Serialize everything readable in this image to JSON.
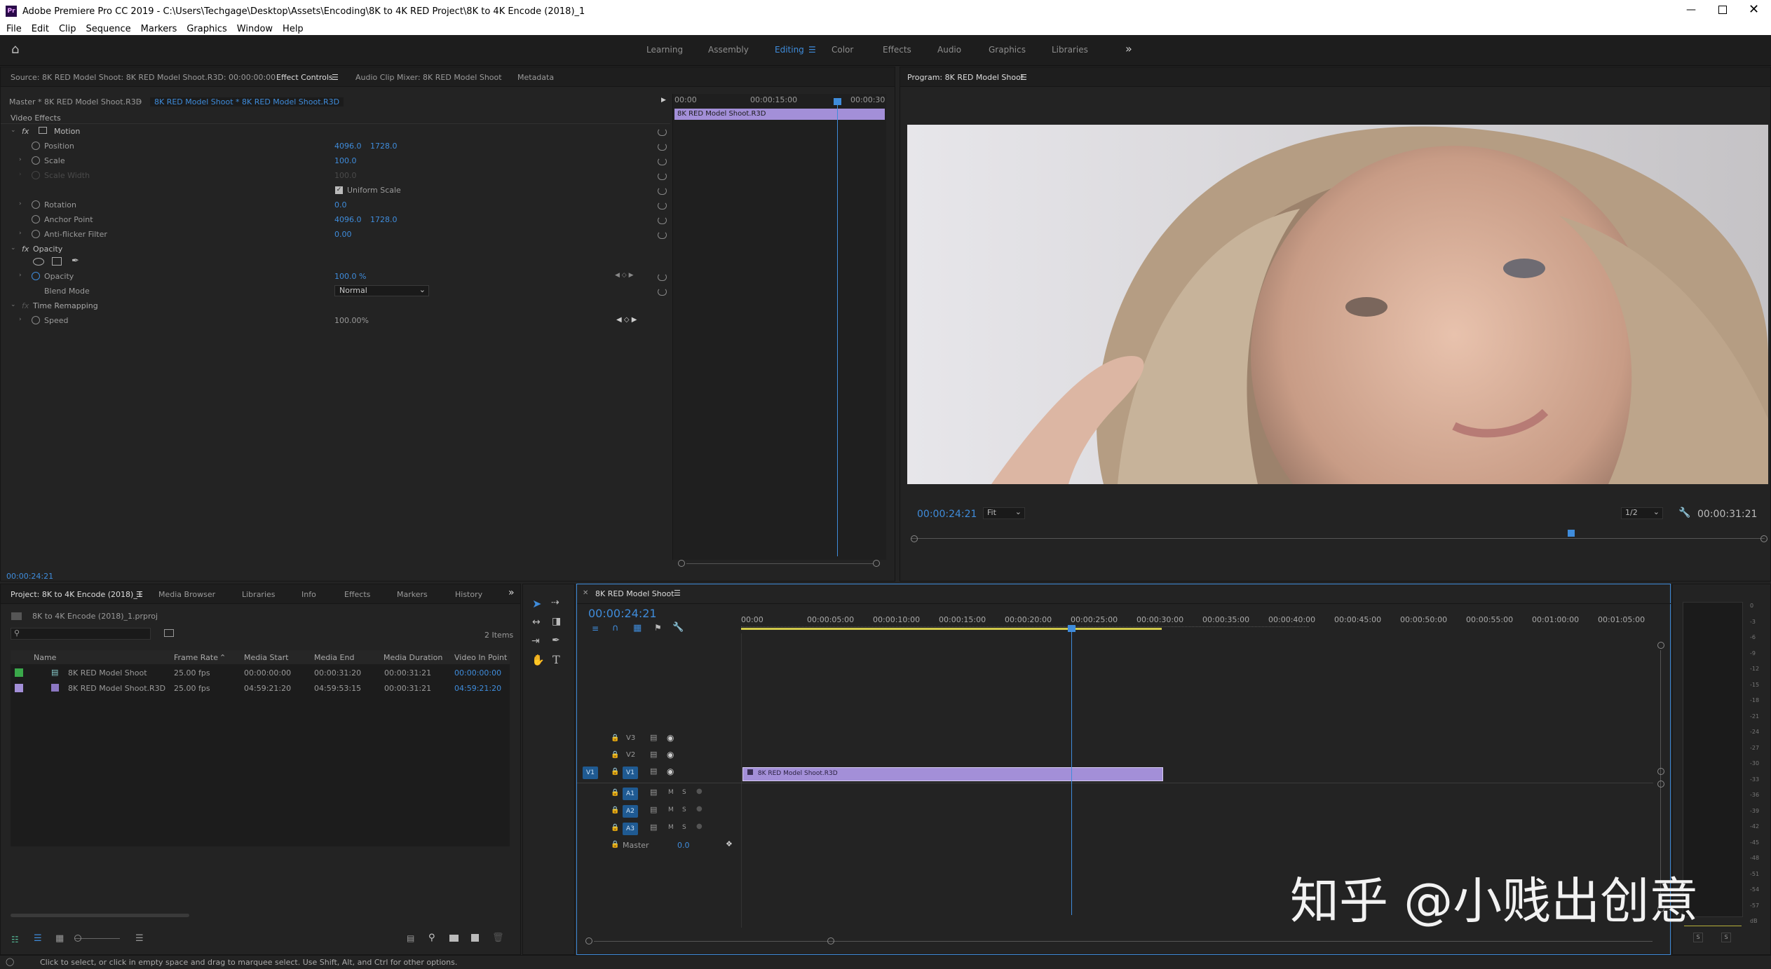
{
  "window": {
    "title": "Adobe Premiere Pro CC 2019 - C:\\Users\\Techgage\\Desktop\\Assets\\Encoding\\8K to 4K RED Project\\8K to 4K Encode (2018)_1",
    "app_icon": "Pr"
  },
  "menu": [
    "File",
    "Edit",
    "Clip",
    "Sequence",
    "Markers",
    "Graphics",
    "Window",
    "Help"
  ],
  "workspaces": [
    "Learning",
    "Assembly",
    "Editing",
    "Color",
    "Effects",
    "Audio",
    "Graphics",
    "Libraries"
  ],
  "source_panel": {
    "tabs": [
      "Source: 8K RED Model Shoot: 8K RED Model Shoot.R3D: 00:00:00:00",
      "Effect Controls",
      "Audio Clip Mixer: 8K RED Model Shoot",
      "Metadata"
    ],
    "master_label": "Master * 8K RED Model Shoot.R3D",
    "clip_label": "8K RED Model Shoot * 8K RED Model Shoot.R3D",
    "ruler": [
      "00:00",
      "00:00:15:00",
      "00:00:30"
    ],
    "clip_bar": "8K RED Model Shoot.R3D",
    "timecode": "00:00:24:21",
    "section": "Video Effects",
    "rows": [
      {
        "label": "Motion",
        "kind": "group"
      },
      {
        "label": "Position",
        "v1": "4096.0",
        "v2": "1728.0"
      },
      {
        "label": "Scale",
        "v1": "100.0"
      },
      {
        "label": "Scale Width",
        "v1": "100.0"
      },
      {
        "label": "Uniform Scale",
        "kind": "check"
      },
      {
        "label": "Rotation",
        "v1": "0.0"
      },
      {
        "label": "Anchor Point",
        "v1": "4096.0",
        "v2": "1728.0"
      },
      {
        "label": "Anti-flicker Filter",
        "v1": "0.00"
      },
      {
        "label": "Opacity",
        "kind": "group"
      },
      {
        "label": "Opacity",
        "v1": "100.0 %"
      },
      {
        "label": "Blend Mode",
        "select": "Normal"
      },
      {
        "label": "Time Remapping",
        "kind": "group"
      },
      {
        "label": "Speed",
        "v1": "100.00%"
      }
    ]
  },
  "program_panel": {
    "title": "Program: 8K RED Model Shoot",
    "timecode": "00:00:24:21",
    "fit": "Fit",
    "resolution": "1/2",
    "duration": "00:00:31:21"
  },
  "project_panel": {
    "tabs": [
      "Project: 8K to 4K Encode (2018)_1",
      "Media Browser",
      "Libraries",
      "Info",
      "Effects",
      "Markers",
      "History"
    ],
    "file": "8K to 4K Encode (2018)_1.prproj",
    "items_count": "2 Items",
    "columns": [
      "Name",
      "Frame Rate",
      "Media Start",
      "Media End",
      "Media Duration",
      "Video In Point"
    ],
    "rows": [
      {
        "color": "#3aa84a",
        "name": "8K RED Model Shoot",
        "fps": "25.00 fps",
        "start": "00:00:00:00",
        "end": "00:00:31:20",
        "duration": "00:00:31:21",
        "in": "00:00:00:00"
      },
      {
        "color": "#a38fd8",
        "name": "8K RED Model Shoot.R3D",
        "fps": "25.00 fps",
        "start": "04:59:21:20",
        "end": "04:59:53:15",
        "duration": "00:00:31:21",
        "in": "04:59:21:20"
      }
    ]
  },
  "timeline": {
    "title": "8K RED Model Shoot",
    "timecode": "00:00:24:21",
    "ruler": [
      "00:00",
      "00:00:05:00",
      "00:00:10:00",
      "00:00:15:00",
      "00:00:20:00",
      "00:00:25:00",
      "00:00:30:00",
      "00:00:35:00",
      "00:00:40:00",
      "00:00:45:00",
      "00:00:50:00",
      "00:00:55:00",
      "00:01:00:00",
      "00:01:05:00"
    ],
    "video_tracks": [
      "V3",
      "V2",
      "V1"
    ],
    "audio_tracks": [
      "A1",
      "A2",
      "A3"
    ],
    "source_patch": "V1",
    "master": "Master",
    "master_value": "0.0",
    "clip": "8K RED Model Shoot.R3D",
    "mute": "M",
    "solo": "S"
  },
  "meter": {
    "scale": [
      "0",
      "-3",
      "-6",
      "-9",
      "-12",
      "-15",
      "-18",
      "-21",
      "-24",
      "-27",
      "-30",
      "-33",
      "-36",
      "-39",
      "-42",
      "-45",
      "-48",
      "-51",
      "-54",
      "-57",
      "dB"
    ],
    "solo": "S"
  },
  "status": "Click to select, or click in empty space and drag to marquee select. Use Shift, Alt, and Ctrl for other options.",
  "watermark": "知乎 @小贱出创意",
  "colors": {
    "accent": "#3f8cdb",
    "clip": "#a38fd8",
    "playhead": "#3f8cdb",
    "bg": "#232323"
  }
}
